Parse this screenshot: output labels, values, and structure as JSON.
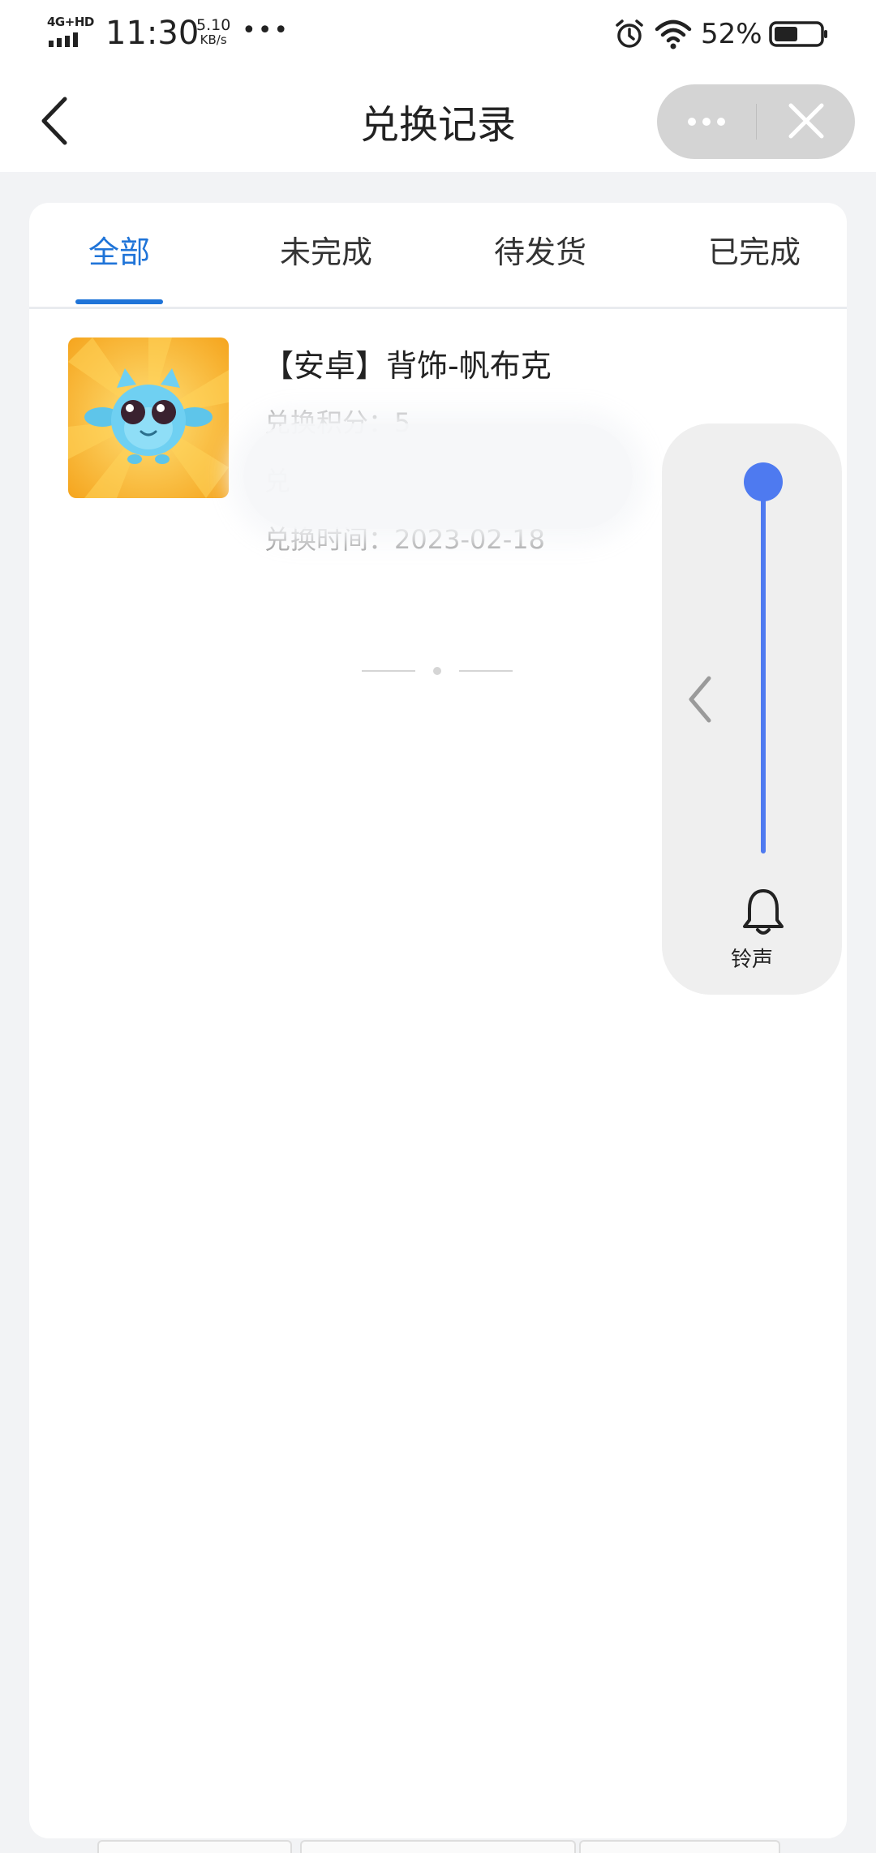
{
  "status_bar": {
    "network": "4G+HD",
    "time": "11:30",
    "speed_value": "5.10",
    "speed_unit": "KB/s",
    "overflow": "•••",
    "battery_percent": "52%",
    "battery_level": 0.52,
    "icons": [
      "signal-bars-icon",
      "alarm-icon",
      "wifi-icon",
      "battery-icon"
    ]
  },
  "nav": {
    "title": "兑换记录",
    "back_icon": "chevron-left-icon",
    "more_icon": "more-dots-icon",
    "close_icon": "close-icon"
  },
  "tabs": [
    {
      "label": "全部",
      "active": true
    },
    {
      "label": "未完成",
      "active": false
    },
    {
      "label": "待发货",
      "active": false
    },
    {
      "label": "已完成",
      "active": false
    }
  ],
  "records": [
    {
      "title": "【安卓】背饰-帆布克",
      "points_text": "兑换积分：5",
      "partial_text": "兑",
      "time_text": "兑换时间：2023-02-18",
      "thumb_icon": "blue-creature-icon"
    }
  ],
  "volume_panel": {
    "label": "铃声",
    "level": 1.0,
    "icons": [
      "chevron-left-icon",
      "bell-icon"
    ]
  },
  "colors": {
    "accent": "#1f74d8",
    "slider": "#4e7af0",
    "background": "#f2f3f5",
    "muted_text": "#9a9a9a"
  }
}
